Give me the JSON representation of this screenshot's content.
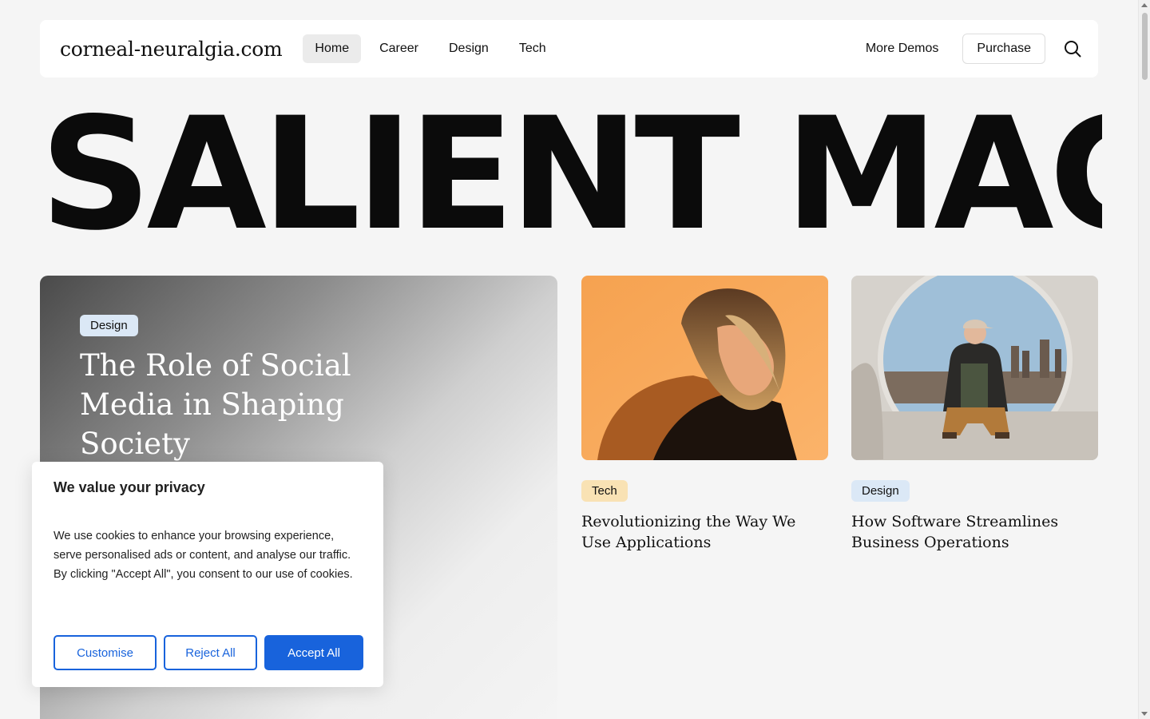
{
  "header": {
    "logo": "corneal-neuralgia.com",
    "nav": [
      {
        "label": "Home",
        "active": true
      },
      {
        "label": "Career",
        "active": false
      },
      {
        "label": "Design",
        "active": false
      },
      {
        "label": "Tech",
        "active": false
      }
    ],
    "more_demos": "More Demos",
    "purchase": "Purchase",
    "search_icon": "search-icon"
  },
  "hero": {
    "title": "SALIENT MAG"
  },
  "feature": {
    "category": "Design",
    "title": "The Role of Social Media in Shaping Society"
  },
  "cards": [
    {
      "category": "Tech",
      "title": "Revolutionizing the Way We Use Applications",
      "image": "woman-orange-portrait"
    },
    {
      "category": "Design",
      "title": "How Software Streamlines Business Operations",
      "image": "man-sitting-circle-window"
    }
  ],
  "cookie": {
    "title": "We value your privacy",
    "text": "We use cookies to enhance your browsing experience, serve personalised ads or content, and analyse our traffic. By clicking \"Accept All\", you consent to our use of cookies.",
    "customise": "Customise",
    "reject": "Reject All",
    "accept": "Accept All"
  },
  "colors": {
    "accent": "#1863dc",
    "badge_design": "#dbe8f6",
    "badge_tech": "#f9e2b4",
    "background": "#f5f5f5"
  }
}
